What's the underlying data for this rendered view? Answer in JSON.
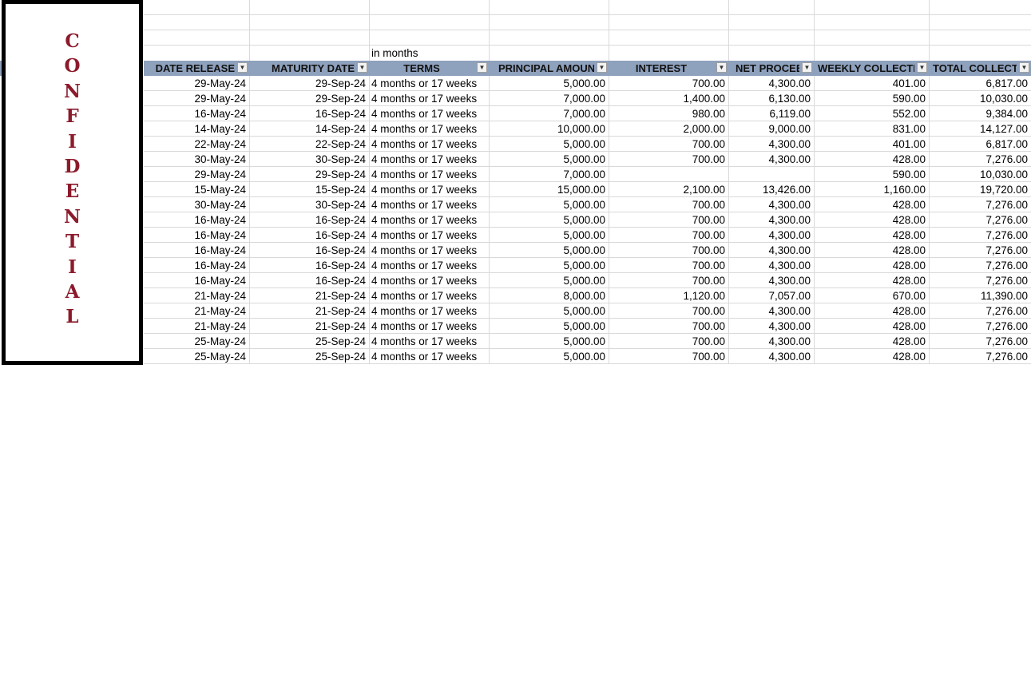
{
  "note_above_terms": "in months",
  "watermark": "CONFIDENTIAL",
  "columns": [
    {
      "key": "date_release",
      "label": "DATE RELEASE"
    },
    {
      "key": "maturity_date",
      "label": "MATURITY DATE"
    },
    {
      "key": "terms",
      "label": "TERMS"
    },
    {
      "key": "principal",
      "label": "PRINCIPAL AMOUNT"
    },
    {
      "key": "interest",
      "label": "INTEREST"
    },
    {
      "key": "net_proceeds",
      "label": "NET PROCEEDS"
    },
    {
      "key": "weekly_collection",
      "label": "WEEKLY COLLECTION"
    },
    {
      "key": "total_collection",
      "label": "TOTAL COLLECTION"
    }
  ],
  "rows": [
    [
      "29-May-24",
      "29-Sep-24",
      "4 months or 17 weeks",
      "5,000.00",
      "700.00",
      "4,300.00",
      "401.00",
      "6,817.00"
    ],
    [
      "29-May-24",
      "29-Sep-24",
      "4 months or 17 weeks",
      "7,000.00",
      "1,400.00",
      "6,130.00",
      "590.00",
      "10,030.00"
    ],
    [
      "16-May-24",
      "16-Sep-24",
      "4 months or 17 weeks",
      "7,000.00",
      "980.00",
      "6,119.00",
      "552.00",
      "9,384.00"
    ],
    [
      "14-May-24",
      "14-Sep-24",
      "4 months or 17 weeks",
      "10,000.00",
      "2,000.00",
      "9,000.00",
      "831.00",
      "14,127.00"
    ],
    [
      "22-May-24",
      "22-Sep-24",
      "4 months or 17 weeks",
      "5,000.00",
      "700.00",
      "4,300.00",
      "401.00",
      "6,817.00"
    ],
    [
      "30-May-24",
      "30-Sep-24",
      "4 months or 17 weeks",
      "5,000.00",
      "700.00",
      "4,300.00",
      "428.00",
      "7,276.00"
    ],
    [
      "29-May-24",
      "29-Sep-24",
      "4 months or 17 weeks",
      "7,000.00",
      "",
      "",
      "590.00",
      "10,030.00"
    ],
    [
      "15-May-24",
      "15-Sep-24",
      "4 months or 17 weeks",
      "15,000.00",
      "2,100.00",
      "13,426.00",
      "1,160.00",
      "19,720.00"
    ],
    [
      "30-May-24",
      "30-Sep-24",
      "4 months or 17 weeks",
      "5,000.00",
      "700.00",
      "4,300.00",
      "428.00",
      "7,276.00"
    ],
    [
      "16-May-24",
      "16-Sep-24",
      "4 months or 17 weeks",
      "5,000.00",
      "700.00",
      "4,300.00",
      "428.00",
      "7,276.00"
    ],
    [
      "16-May-24",
      "16-Sep-24",
      "4 months or 17 weeks",
      "5,000.00",
      "700.00",
      "4,300.00",
      "428.00",
      "7,276.00"
    ],
    [
      "16-May-24",
      "16-Sep-24",
      "4 months or 17 weeks",
      "5,000.00",
      "700.00",
      "4,300.00",
      "428.00",
      "7,276.00"
    ],
    [
      "16-May-24",
      "16-Sep-24",
      "4 months or 17 weeks",
      "5,000.00",
      "700.00",
      "4,300.00",
      "428.00",
      "7,276.00"
    ],
    [
      "16-May-24",
      "16-Sep-24",
      "4 months or 17 weeks",
      "5,000.00",
      "700.00",
      "4,300.00",
      "428.00",
      "7,276.00"
    ],
    [
      "21-May-24",
      "21-Sep-24",
      "4 months or 17 weeks",
      "8,000.00",
      "1,120.00",
      "7,057.00",
      "670.00",
      "11,390.00"
    ],
    [
      "21-May-24",
      "21-Sep-24",
      "4 months or 17 weeks",
      "5,000.00",
      "700.00",
      "4,300.00",
      "428.00",
      "7,276.00"
    ],
    [
      "21-May-24",
      "21-Sep-24",
      "4 months or 17 weeks",
      "5,000.00",
      "700.00",
      "4,300.00",
      "428.00",
      "7,276.00"
    ],
    [
      "25-May-24",
      "25-Sep-24",
      "4 months or 17 weeks",
      "5,000.00",
      "700.00",
      "4,300.00",
      "428.00",
      "7,276.00"
    ],
    [
      "25-May-24",
      "25-Sep-24",
      "4 months or 17 weeks",
      "5,000.00",
      "700.00",
      "4,300.00",
      "428.00",
      "7,276.00"
    ]
  ],
  "colors": {
    "header_fill": "#8ea1bd",
    "watermark": "#8b1a2b"
  }
}
